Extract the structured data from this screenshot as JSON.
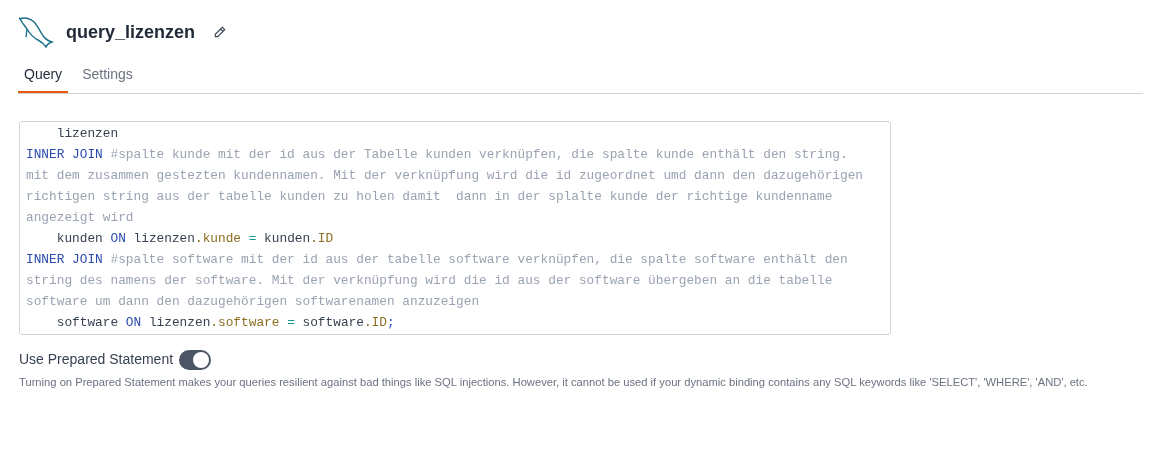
{
  "header": {
    "title": "query_lizenzen"
  },
  "tabs": [
    {
      "label": "Query",
      "selected": true
    },
    {
      "label": "Settings",
      "selected": false
    }
  ],
  "editor": {
    "lines": [
      [
        {
          "kind": "plain",
          "text": "    lizenzen"
        }
      ],
      [
        {
          "kind": "keyword",
          "text": "INNER JOIN"
        },
        {
          "kind": "comment",
          "text": " #spalte kunde mit der id aus der Tabelle kunden verknüpfen, die spalte kunde enthält den string."
        }
      ],
      [
        {
          "kind": "comment",
          "text": "mit dem zusammen gestezten kundennamen. Mit der verknüpfung wird die id zugeordnet umd dann den dazugehörigen"
        }
      ],
      [
        {
          "kind": "comment",
          "text": "richtigen string aus der tabelle kunden zu holen damit  dann in der splalte kunde der richtige kundenname"
        }
      ],
      [
        {
          "kind": "comment",
          "text": "angezeigt wird"
        }
      ],
      [
        {
          "kind": "plain",
          "text": "    kunden "
        },
        {
          "kind": "keyword",
          "text": "ON"
        },
        {
          "kind": "plain",
          "text": " lizenzen"
        },
        {
          "kind": "property",
          "text": ".kunde"
        },
        {
          "kind": "operator",
          "text": " = "
        },
        {
          "kind": "plain",
          "text": "kunden"
        },
        {
          "kind": "property",
          "text": ".ID"
        }
      ],
      [
        {
          "kind": "keyword",
          "text": "INNER JOIN"
        },
        {
          "kind": "comment",
          "text": " #spalte software mit der id aus der tabelle software verknüpfen, die spalte software enthält den"
        }
      ],
      [
        {
          "kind": "comment",
          "text": "string des namens der software. Mit der verknüpfung wird die id aus der software übergeben an die tabelle"
        }
      ],
      [
        {
          "kind": "comment",
          "text": "software um dann den dazugehörigen softwarenamen anzuzeigen"
        }
      ],
      [
        {
          "kind": "plain",
          "text": "    software "
        },
        {
          "kind": "keyword",
          "text": "ON"
        },
        {
          "kind": "plain",
          "text": " lizenzen"
        },
        {
          "kind": "property",
          "text": ".software"
        },
        {
          "kind": "operator",
          "text": " = "
        },
        {
          "kind": "plain",
          "text": "software"
        },
        {
          "kind": "property",
          "text": ".ID"
        },
        {
          "kind": "punct",
          "text": ";"
        }
      ]
    ]
  },
  "prepared_statement": {
    "label": "Use Prepared Statement",
    "on": true,
    "description": "Turning on Prepared Statement makes your queries resilient against bad things like SQL injections. However, it cannot be used if your dynamic binding contains any SQL keywords like 'SELECT', 'WHERE', 'AND', etc."
  }
}
